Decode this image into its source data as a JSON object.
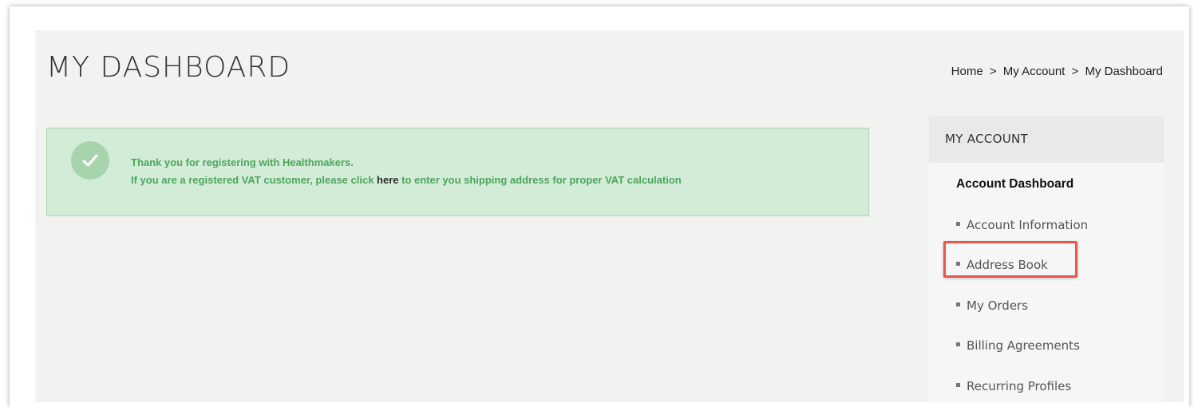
{
  "page": {
    "title": "MY DASHBOARD"
  },
  "breadcrumb": {
    "items": [
      "Home",
      "My Account",
      "My Dashboard"
    ],
    "separator": ">"
  },
  "success_message": {
    "line1": "Thank you for registering with Healthmakers.",
    "line2_before": "If you are a registered VAT customer, please click ",
    "line2_link": "here",
    "line2_after": " to enter you shipping address for proper VAT calculation",
    "icon": "checkmark-icon"
  },
  "sidebar": {
    "header": "MY ACCOUNT",
    "items": [
      {
        "label": "Account Dashboard",
        "current": true
      },
      {
        "label": "Account Information",
        "current": false
      },
      {
        "label": "Address Book",
        "current": false
      },
      {
        "label": "My Orders",
        "current": false
      },
      {
        "label": "Billing Agreements",
        "current": false
      },
      {
        "label": "Recurring Profiles",
        "current": false
      }
    ]
  },
  "colors": {
    "success_bg": "#d2ecd7",
    "success_text": "#4ea55d",
    "highlight": "#e8584b"
  }
}
